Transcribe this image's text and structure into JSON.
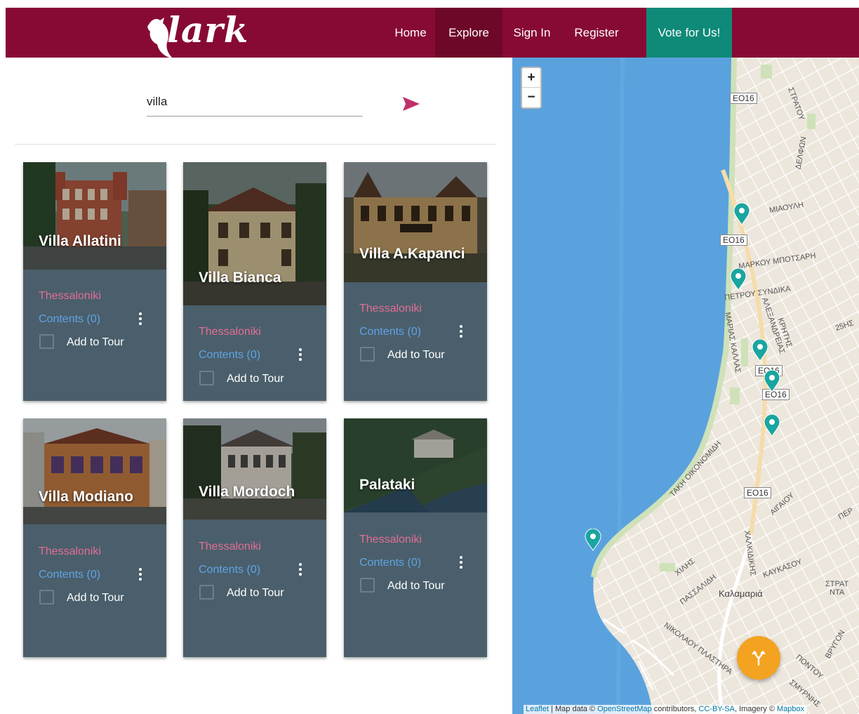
{
  "brand": {
    "logo_text": "lark"
  },
  "nav": {
    "home": "Home",
    "explore": "Explore",
    "signin": "Sign In",
    "register": "Register",
    "vote": "Vote for Us!"
  },
  "search": {
    "value": "villa"
  },
  "card_labels": {
    "city": "Thessaloniki",
    "contents": "Contents (0)",
    "add_to_tour": "Add to Tour"
  },
  "cards": [
    {
      "title": "Villa Allatini"
    },
    {
      "title": "Villa Bianca"
    },
    {
      "title": "Villa A.Kapanci"
    },
    {
      "title": "Villa Modiano"
    },
    {
      "title": "Villa Mordoch"
    },
    {
      "title": "Palataki"
    }
  ],
  "map": {
    "zoom_in": "+",
    "zoom_out": "−",
    "attribution": {
      "leaflet": "Leaflet",
      "sep": " | Map data © ",
      "osm": "OpenStreetMap",
      "contributors": " contributors, ",
      "license": "CC-BY-SA",
      "imagery": ", Imagery © ",
      "mapbox": "Mapbox"
    },
    "labels": {
      "eo16_a": "ΕΟ16",
      "eo16_b": "ΕΟ16",
      "eo16_c": "ΕΟ16",
      "eo16_d": "ΕΟ16",
      "eo16_e": "ΕΟ16",
      "miaoulh": "ΜΙΑΟΥΛΗ",
      "mpotsarh": "ΜΑΡΚΟΥ ΜΠΟΤΣΑΡΗ",
      "syndika": "ΠΕΤΡΟΥ ΣΥΝΔΙΚΑ",
      "kalamaria": "Καλαμαριά",
      "stratoy": "ΣΤΡΑΤΟΥ",
      "delfon": "ΔΕΛΦΩΝ",
      "oikonomidh": "ΤΑΚΗ ΟΙΚΟΝΟΜΙΔΗ",
      "aigaiou": "ΑΙΓΑΙΟΥ",
      "plastira": "ΝΙΚΟΛΑΟΥ ΠΛΑΣΤΗΡΑ",
      "kaykasou": "ΚΑΥΚΑΣΟΥ",
      "passalidh": "ΠΑΣΣΑΛΙΔΗ",
      "xilhs": "ΧΙΛΗΣ",
      "pontoy": "ΠΟΝΤΟΥ",
      "kallas": "ΜΑΡΙΑΣ ΚΑΛΛΑΣ",
      "alexandreias": "ΑΛΕΞΑΝΔΡΕΙΑΣ",
      "krhths": "ΚΡΗΤΗΣ",
      "chalkidikis": "ΧΑΛΚΙΔΙΚΗΣ",
      "smyrnhs": "ΣΜΥΡΝΗΣ",
      "vrygon": "ΒΡΥΓΟΝ",
      "stratou2": "ΣΤΡΑΤ",
      "nta": "ΝΤΑ",
      "paer": "ΠΕΡ",
      "z5h": "25ΗΣ"
    }
  },
  "colors": {
    "navbar": "#870a35",
    "nav_active": "#6e0828",
    "vote": "#0f8a78",
    "card": "#4a5f6b",
    "city": "#e36d95",
    "contents": "#5fa3e6",
    "sea": "#5aa2de",
    "land": "#ece6dc",
    "marker": "#1aa5a0",
    "fab": "#f3a31f",
    "send": "#c0306a"
  },
  "icons": {
    "send": "send-icon",
    "menu": "more-vertical-icon",
    "fab": "split-route-icon",
    "marker": "map-marker-icon"
  }
}
